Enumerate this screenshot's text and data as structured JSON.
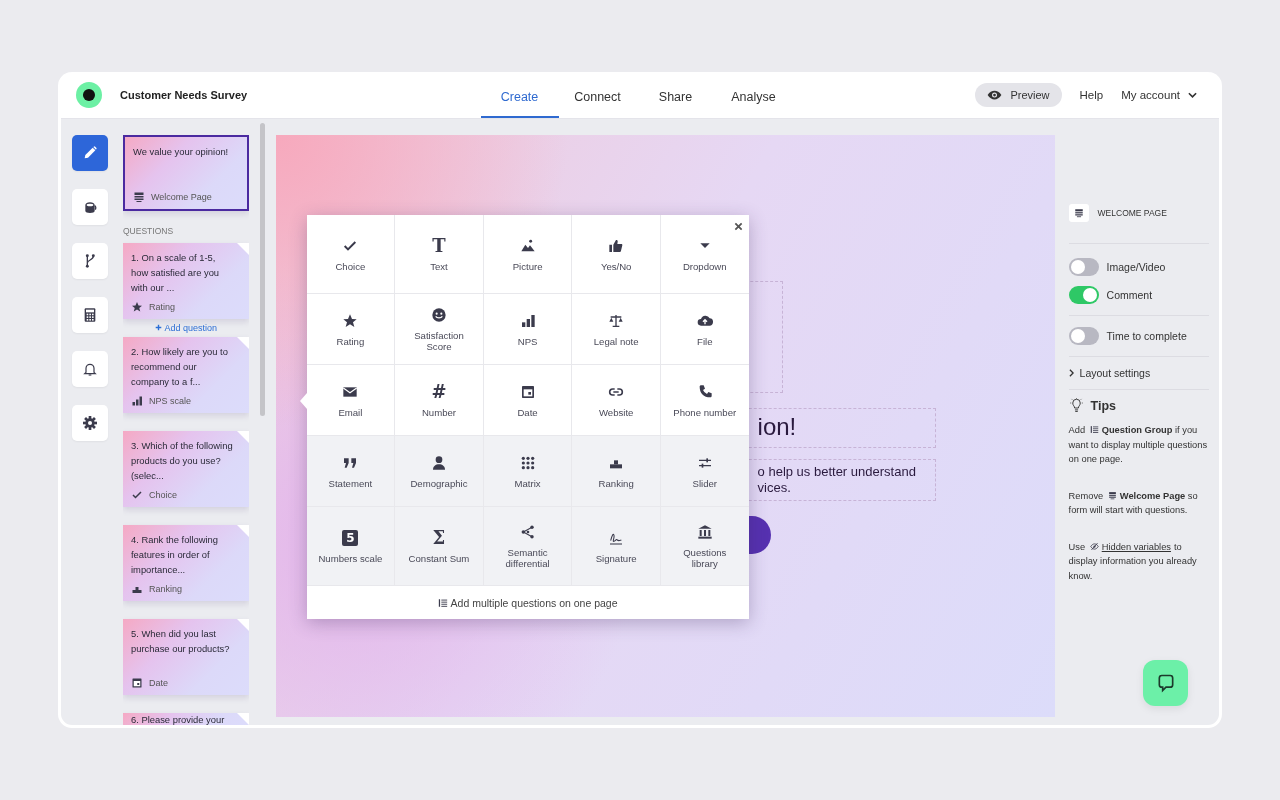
{
  "header": {
    "title": "Customer Needs Survey",
    "tabs": [
      {
        "label": "Create",
        "selected": true
      },
      {
        "label": "Connect",
        "selected": false
      },
      {
        "label": "Share",
        "selected": false
      },
      {
        "label": "Analyse",
        "selected": false
      }
    ],
    "preview": "Preview",
    "help": "Help",
    "account": "My account"
  },
  "rail": [
    {
      "kind": "edit",
      "selected": true
    },
    {
      "kind": "design",
      "selected": false
    },
    {
      "kind": "logic",
      "selected": false
    },
    {
      "kind": "calculator",
      "selected": false
    },
    {
      "kind": "notifications",
      "selected": false
    },
    {
      "kind": "settings",
      "selected": false
    }
  ],
  "welcome_card": {
    "text": "We value your opinion!",
    "type": "Welcome Page",
    "selected": true
  },
  "questions_heading": "QUESTIONS",
  "add_question": "Add question",
  "questions": [
    {
      "text": "1. On a scale of 1-5, how satisfied are you with our ...",
      "type": "Rating",
      "kind": "rating"
    },
    {
      "text": "2. How likely are you to recommend our company to a f...",
      "type": "NPS scale",
      "kind": "nps"
    },
    {
      "text": "3. Which of the following products do you use? (selec...",
      "type": "Choice",
      "kind": "choice"
    },
    {
      "text": "4. Rank the following features in order of importance...",
      "type": "Ranking",
      "kind": "ranking"
    },
    {
      "text": "5. When did you last purchase our products?",
      "type": "Date",
      "kind": "date"
    },
    {
      "text": "6. Please provide your",
      "kind": "partial"
    }
  ],
  "canvas": {
    "heading": "ion!",
    "description_lines": [
      "o help us better understand",
      "vices."
    ]
  },
  "question_types": {
    "items": [
      {
        "label": "Choice",
        "kind": "choice"
      },
      {
        "label": "Text",
        "glyph": "T"
      },
      {
        "label": "Picture",
        "kind": "picture"
      },
      {
        "label": "Yes/No",
        "kind": "yesno"
      },
      {
        "label": "Dropdown",
        "kind": "dropdown"
      },
      {
        "label": "Rating",
        "kind": "rating"
      },
      {
        "label": "Satisfaction Score",
        "kind": "smiley"
      },
      {
        "label": "NPS",
        "kind": "nps"
      },
      {
        "label": "Legal note",
        "kind": "legal"
      },
      {
        "label": "File",
        "kind": "file"
      },
      {
        "label": "Email",
        "kind": "email"
      },
      {
        "label": "Number",
        "glyph": "#"
      },
      {
        "label": "Date",
        "kind": "date"
      },
      {
        "label": "Website",
        "kind": "website"
      },
      {
        "label": "Phone number",
        "kind": "phone"
      },
      {
        "label": "Statement",
        "kind": "statement"
      },
      {
        "label": "Demographic",
        "kind": "demographic"
      },
      {
        "label": "Matrix",
        "kind": "matrix"
      },
      {
        "label": "Ranking",
        "kind": "ranking"
      },
      {
        "label": "Slider",
        "kind": "slider"
      },
      {
        "label": "Numbers scale",
        "glyph": "5",
        "kind": "boxed"
      },
      {
        "label": "Constant Sum",
        "glyph": "Σ"
      },
      {
        "label": "Semantic differential",
        "kind": "semantic"
      },
      {
        "label": "Signature",
        "kind": "signature"
      },
      {
        "label": "Questions library",
        "kind": "library"
      }
    ],
    "footer": "Add multiple questions on one page"
  },
  "settings": {
    "section": "WELCOME PAGE",
    "toggles": [
      {
        "label": "Image/Video",
        "on": false
      },
      {
        "label": "Comment",
        "on": true
      },
      {
        "label": "Time to complete",
        "on": false
      }
    ],
    "layout": "Layout settings",
    "tips_title": "Tips",
    "tips": [
      {
        "before": "Add",
        "after": "**Question Group** if you want to display multiple questions on one page."
      },
      {
        "before": "Remove",
        "after": "**Welcome Page** so form will start with questions."
      },
      {
        "before": "Use",
        "link": "Hidden variables",
        "after": "to display information you already know."
      }
    ]
  }
}
